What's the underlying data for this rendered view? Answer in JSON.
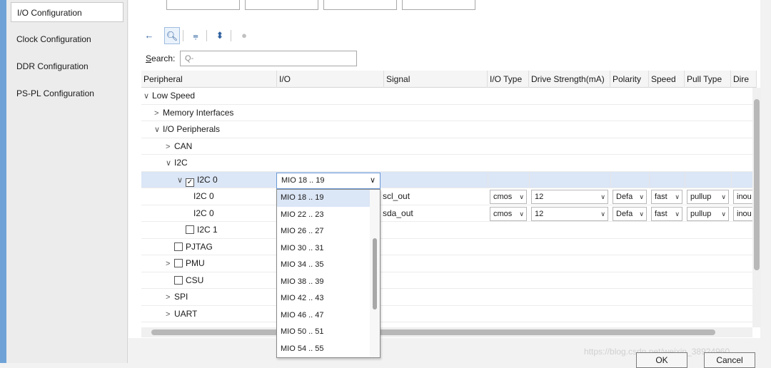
{
  "sidebar": {
    "items": [
      {
        "label": "I/O Configuration",
        "active": true
      },
      {
        "label": "Clock Configuration"
      },
      {
        "label": "DDR Configuration"
      },
      {
        "label": "PS-PL Configuration"
      }
    ]
  },
  "toolbar": {
    "icons": [
      "back-arrow-icon",
      "search-icon",
      "collapse-all-icon",
      "expand-all-icon",
      "status-dot-icon"
    ]
  },
  "search": {
    "label_prefix": "S",
    "label_rest": "earch:",
    "placeholder": "Q-"
  },
  "table": {
    "columns": [
      "Peripheral",
      "I/O",
      "Signal",
      "I/O Type",
      "Drive Strength(mA)",
      "Polarity",
      "Speed",
      "Pull Type",
      "Dire"
    ],
    "rows": [
      {
        "peripheral": "Low Speed"
      },
      {
        "peripheral": "Memory Interfaces"
      },
      {
        "peripheral": "I/O Peripherals"
      },
      {
        "peripheral": "CAN"
      },
      {
        "peripheral": "I2C"
      },
      {
        "peripheral": "I2C 0"
      },
      {
        "peripheral": "I2C 0",
        "signal": "scl_out",
        "io_type": "cmos",
        "drive": "12",
        "polarity": "Defa",
        "speed": "fast",
        "pull": "pullup",
        "dir": "inou"
      },
      {
        "peripheral": "I2C 0",
        "signal": "sda_out",
        "io_type": "cmos",
        "drive": "12",
        "polarity": "Defa",
        "speed": "fast",
        "pull": "pullup",
        "dir": "inou"
      },
      {
        "peripheral": "I2C 1"
      },
      {
        "peripheral": "PJTAG"
      },
      {
        "peripheral": "PMU"
      },
      {
        "peripheral": "CSU"
      },
      {
        "peripheral": "SPI"
      },
      {
        "peripheral": "UART"
      }
    ]
  },
  "io_select": {
    "value": "MIO 18 .. 19",
    "options": [
      "MIO 18 .. 19",
      "MIO 22 .. 23",
      "MIO 26 .. 27",
      "MIO 30 .. 31",
      "MIO 34 .. 35",
      "MIO 38 .. 39",
      "MIO 42 .. 43",
      "MIO 46 .. 47",
      "MIO 50 .. 51",
      "MIO 54 .. 55"
    ]
  },
  "buttons": {
    "ok": "OK",
    "cancel": "Cancel"
  },
  "watermark": "https://blog.csdn.net/weixin_38924960",
  "colors": {
    "selection": "#dbe6f6",
    "accent": "#2a5d9e",
    "focus_border": "#6a98d6"
  }
}
